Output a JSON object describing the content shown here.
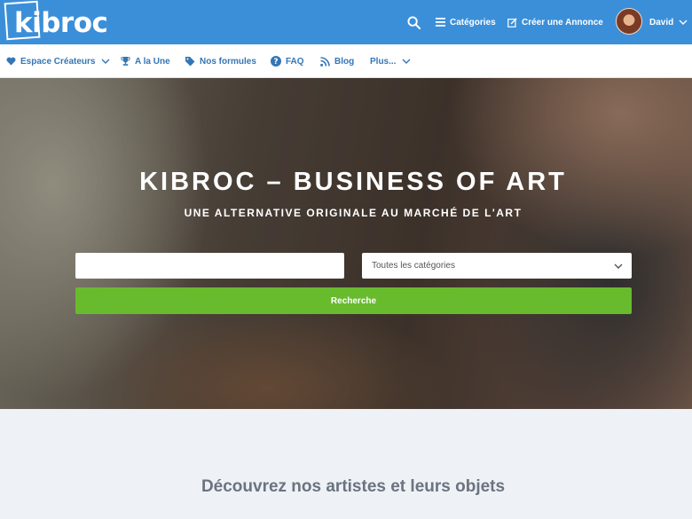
{
  "brand": {
    "name": "Kibroc",
    "logo_text": "kibroc",
    "primary_color": "#3b8fd9",
    "accent_color": "#69bb2e"
  },
  "topbar": {
    "search_icon": "search-icon",
    "categories_label": "Catégories",
    "create_label": "Créer une Annonce",
    "user_name": "David"
  },
  "subnav": {
    "items": [
      {
        "label": "Espace Créateurs",
        "icon": "heart-icon",
        "has_dropdown": true
      },
      {
        "label": "A la Une",
        "icon": "trophy-icon",
        "has_dropdown": false
      },
      {
        "label": "Nos formules",
        "icon": "tag-icon",
        "has_dropdown": false
      },
      {
        "label": "FAQ",
        "icon": "question-icon",
        "has_dropdown": false
      },
      {
        "label": "Blog",
        "icon": "rss-icon",
        "has_dropdown": false
      },
      {
        "label": "Plus...",
        "icon": "",
        "has_dropdown": true
      }
    ]
  },
  "hero": {
    "title": "KIBROC – BUSINESS OF ART",
    "subtitle": "UNE ALTERNATIVE ORIGINALE AU MARCHÉ DE L'ART",
    "search": {
      "value": "",
      "placeholder": ""
    },
    "category_select": {
      "selected": "Toutes les catégories"
    },
    "search_button": "Recherche"
  },
  "section": {
    "title": "Découvrez nos artistes et leurs objets"
  }
}
